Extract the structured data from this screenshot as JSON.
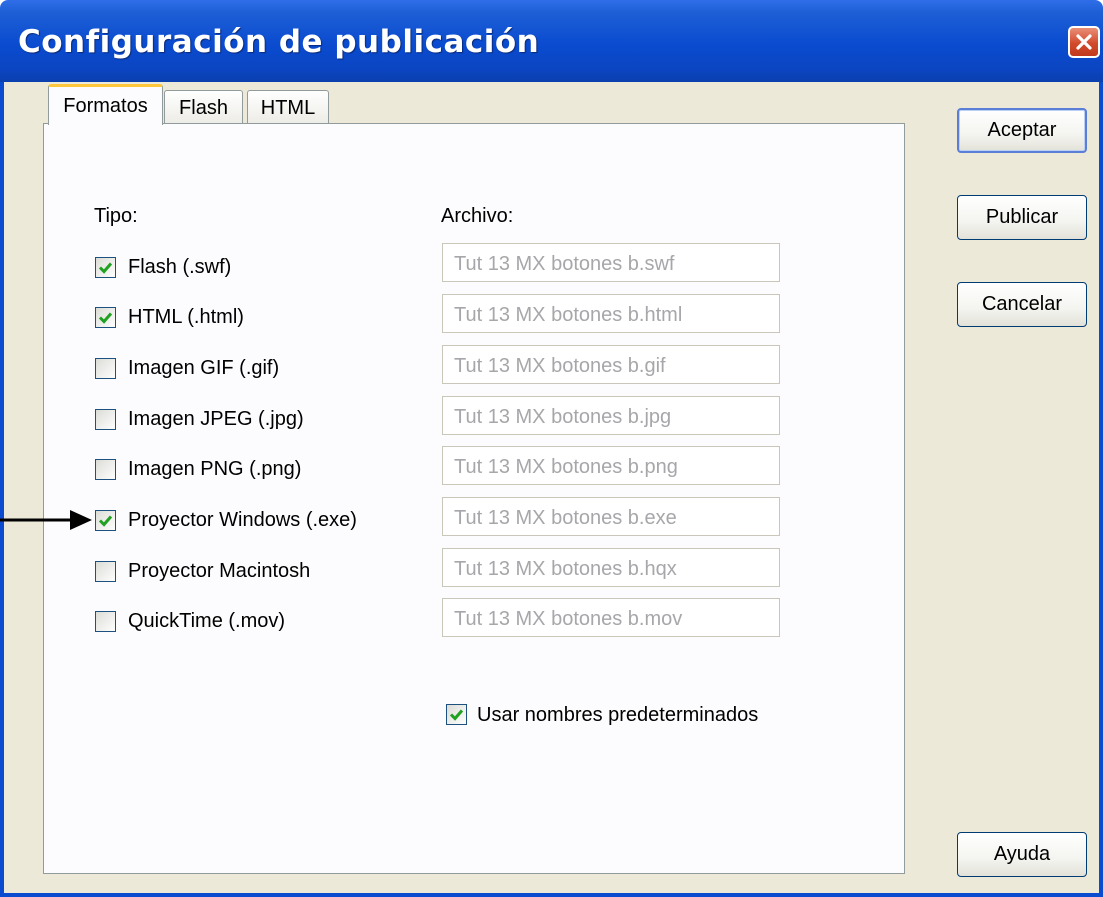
{
  "window": {
    "title": "Configuración de publicación"
  },
  "tabs": [
    "Formatos",
    "Flash",
    "HTML"
  ],
  "headers": {
    "type": "Tipo:",
    "file": "Archivo:"
  },
  "formats": [
    {
      "label": "Flash  (.swf)",
      "checked": true,
      "file": "Tut 13 MX botones b.swf"
    },
    {
      "label": "HTML (.html)",
      "checked": true,
      "file": "Tut 13 MX botones b.html"
    },
    {
      "label": "Imagen GIF (.gif)",
      "checked": false,
      "file": "Tut 13 MX botones b.gif"
    },
    {
      "label": "Imagen JPEG (.jpg)",
      "checked": false,
      "file": "Tut 13 MX botones b.jpg"
    },
    {
      "label": "Imagen PNG (.png)",
      "checked": false,
      "file": "Tut 13 MX botones b.png"
    },
    {
      "label": "Proyector Windows (.exe)",
      "checked": true,
      "file": "Tut 13 MX botones b.exe"
    },
    {
      "label": "Proyector Macintosh",
      "checked": false,
      "file": "Tut 13 MX botones b.hqx"
    },
    {
      "label": "QuickTime (.mov)",
      "checked": false,
      "file": "Tut 13 MX botones b.mov"
    }
  ],
  "default_names": {
    "label": "Usar nombres predeterminados",
    "checked": true
  },
  "buttons": {
    "accept": "Aceptar",
    "publish": "Publicar",
    "cancel": "Cancelar",
    "help": "Ayuda"
  },
  "colors": {
    "titlebar": "#0a4bd0",
    "active_tab_accent": "#ffc73c",
    "check": "#21a121"
  },
  "icons": {
    "close": "close-icon",
    "check": "check-icon",
    "annotation": "arrow-right-icon"
  }
}
